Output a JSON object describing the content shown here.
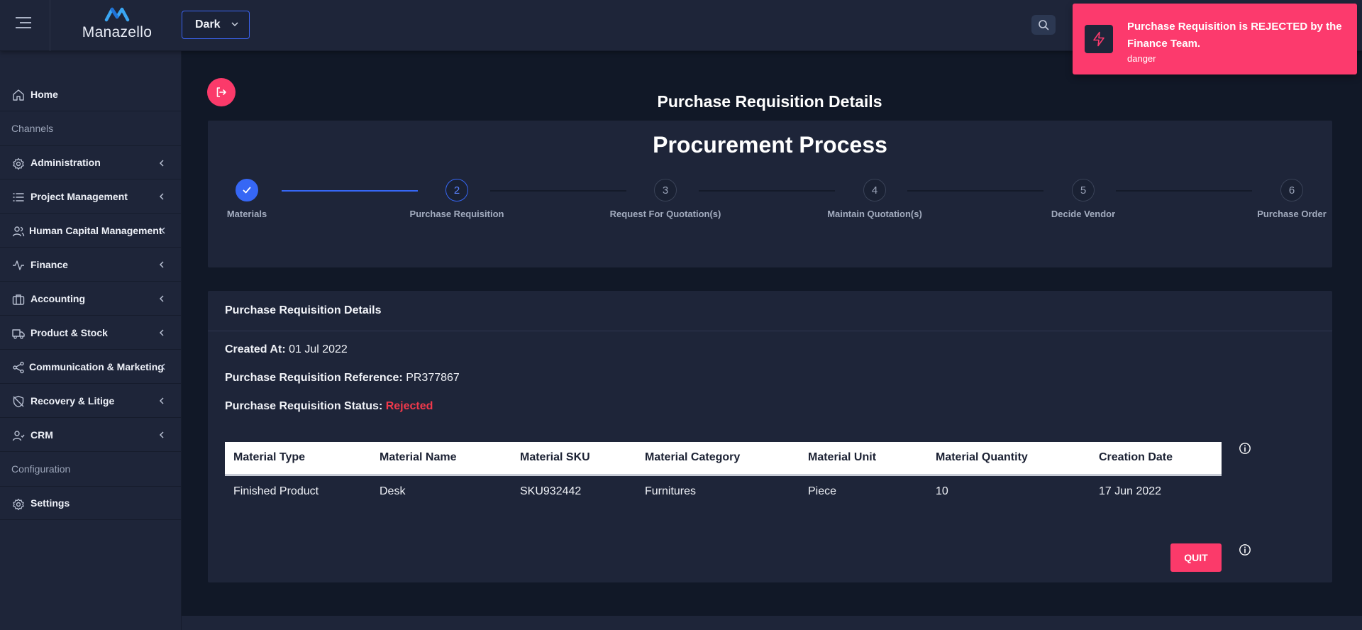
{
  "header": {
    "app_name": "Manazello",
    "theme_value": "Dark"
  },
  "sidebar": {
    "items": [
      {
        "label": "Home",
        "icon": "home-icon"
      },
      {
        "label": "Administration",
        "icon": "gear-icon"
      },
      {
        "label": "Project Management",
        "icon": "list-icon"
      },
      {
        "label": "Human Capital Management",
        "icon": "users-icon"
      },
      {
        "label": "Finance",
        "icon": "activity-icon"
      },
      {
        "label": "Accounting",
        "icon": "briefcase-icon"
      },
      {
        "label": "Product & Stock",
        "icon": "truck-icon"
      },
      {
        "label": "Communication & Marketing",
        "icon": "share-icon"
      },
      {
        "label": "Recovery & Litige",
        "icon": "shield-off-icon"
      },
      {
        "label": "CRM",
        "icon": "user-group-icon"
      },
      {
        "label": "Settings",
        "icon": "settings-icon"
      }
    ],
    "sections": [
      "Channels",
      "Configuration"
    ]
  },
  "page": {
    "title": "Purchase Requisition Details"
  },
  "process": {
    "title": "Procurement Process",
    "steps": [
      {
        "number": "1",
        "label": "Materials",
        "state": "done"
      },
      {
        "number": "2",
        "label": "Purchase Requisition",
        "state": "active"
      },
      {
        "number": "3",
        "label": "Request For Quotation(s)",
        "state": "pending"
      },
      {
        "number": "4",
        "label": "Maintain Quotation(s)",
        "state": "pending"
      },
      {
        "number": "5",
        "label": "Decide Vendor",
        "state": "pending"
      },
      {
        "number": "6",
        "label": "Purchase Order",
        "state": "pending"
      }
    ]
  },
  "details": {
    "header": "Purchase Requisition Details",
    "created_at_label": "Created At:",
    "created_at_value": "01 Jul 2022",
    "reference_label": "Purchase Requisition Reference:",
    "reference_value": "PR377867",
    "status_label": "Purchase Requisition Status:",
    "status_value": "Rejected",
    "table": {
      "columns": [
        "Material Type",
        "Material Name",
        "Material SKU",
        "Material Category",
        "Material Unit",
        "Material Quantity",
        "Creation Date"
      ],
      "rows": [
        [
          "Finished Product",
          "Desk",
          "SKU932442",
          "Furnitures",
          "Piece",
          "10",
          "17 Jun 2022"
        ]
      ]
    },
    "quit_label": "QUIT"
  },
  "toast": {
    "message": "Purchase Requisition is REJECTED by the Finance Team.",
    "type": "danger"
  },
  "colors": {
    "accent": "#3667f5",
    "danger": "#fc3a6d",
    "rejected_text": "#f0394b",
    "panel": "#1e2539",
    "background": "#111827"
  }
}
